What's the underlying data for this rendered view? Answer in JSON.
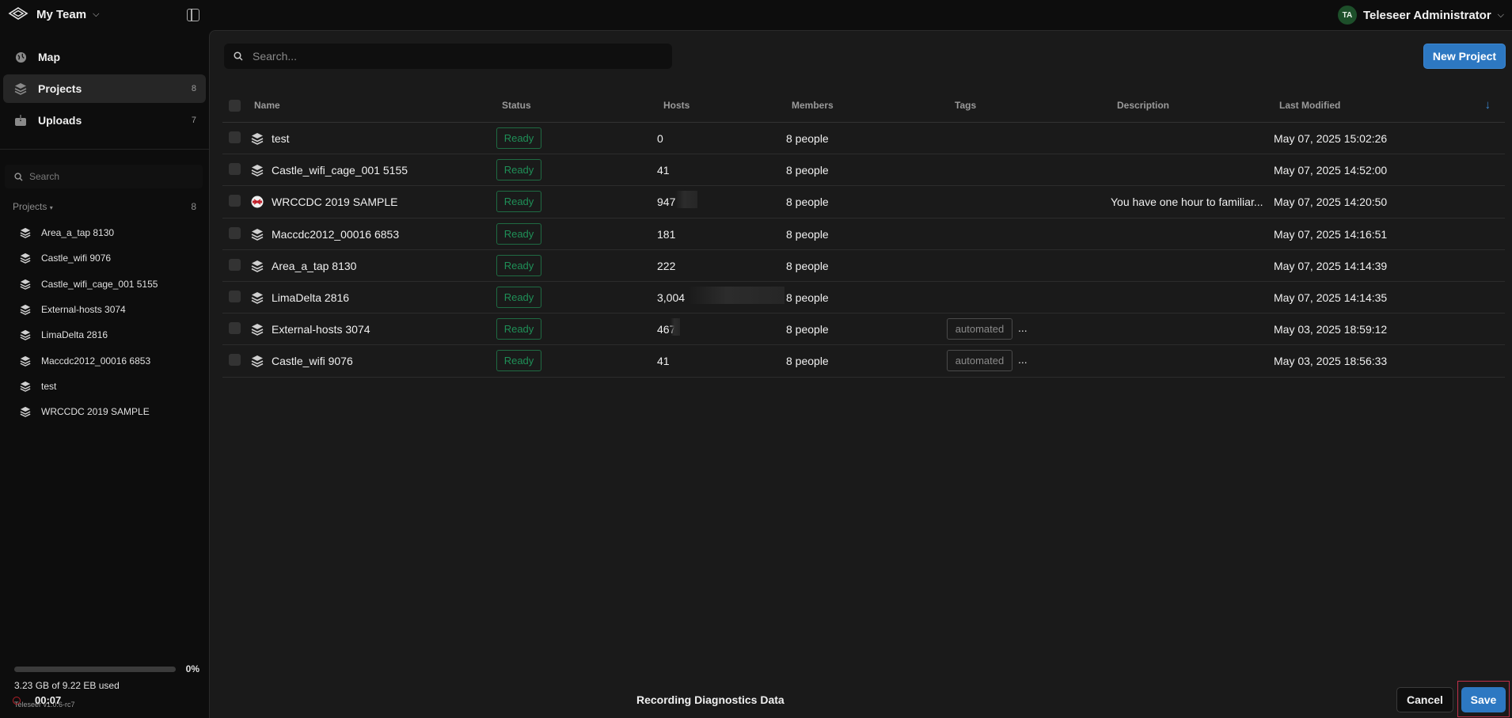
{
  "header": {
    "team": "My Team",
    "user_initials": "TA",
    "user_name": "Teleseer Administrator"
  },
  "nav": [
    {
      "label": "Map",
      "count": "",
      "icon": "globe-icon"
    },
    {
      "label": "Projects",
      "count": "8",
      "icon": "layers-icon"
    },
    {
      "label": "Uploads",
      "count": "7",
      "icon": "inbox-upload-icon"
    }
  ],
  "sidebar": {
    "search_placeholder": "Search",
    "projects_label": "Projects",
    "projects_count": "8",
    "projects": [
      "Area_a_tap 8130",
      "Castle_wifi 9076",
      "Castle_wifi_cage_001 5155",
      "External-hosts 3074",
      "LimaDelta 2816",
      "Maccdc2012_00016 6853",
      "test",
      "WRCCDC 2019 SAMPLE"
    ],
    "storage_pct": "0%",
    "storage_used": "3.23 GB of 9.22 EB used",
    "recording_time": "00:07",
    "version": "Teleseer v1.0.6-rc7"
  },
  "main": {
    "search_placeholder": "Search...",
    "new_project": "New Project",
    "columns": {
      "name": "Name",
      "status": "Status",
      "hosts": "Hosts",
      "members": "Members",
      "tags": "Tags",
      "description": "Description",
      "last_modified": "Last Modified"
    },
    "rows": [
      {
        "name": "test",
        "status": "Ready",
        "hosts": "0",
        "members": "8 people",
        "tag": "",
        "description": "",
        "modified": "May 07, 2025 15:02:26"
      },
      {
        "name": "Castle_wifi_cage_001 5155",
        "status": "Ready",
        "hosts": "41",
        "members": "8 people",
        "tag": "",
        "description": "",
        "modified": "May 07, 2025 14:52:00"
      },
      {
        "name": "WRCCDC 2019 SAMPLE",
        "status": "Ready",
        "hosts": "947",
        "members": "8 people",
        "tag": "",
        "description": "You have one hour to familiar...",
        "modified": "May 07, 2025 14:20:50"
      },
      {
        "name": "Maccdc2012_00016 6853",
        "status": "Ready",
        "hosts": "181",
        "members": "8 people",
        "tag": "",
        "description": "",
        "modified": "May 07, 2025 14:16:51"
      },
      {
        "name": "Area_a_tap 8130",
        "status": "Ready",
        "hosts": "222",
        "members": "8 people",
        "tag": "",
        "description": "",
        "modified": "May 07, 2025 14:14:39"
      },
      {
        "name": "LimaDelta 2816",
        "status": "Ready",
        "hosts": "3,004",
        "members": "8 people",
        "tag": "",
        "description": "",
        "modified": "May 07, 2025 14:14:35"
      },
      {
        "name": "External-hosts 3074",
        "status": "Ready",
        "hosts": "467",
        "members": "8 people",
        "tag": "automated",
        "description": "",
        "modified": "May 03, 2025 18:59:12"
      },
      {
        "name": "Castle_wifi 9076",
        "status": "Ready",
        "hosts": "41",
        "members": "8 people",
        "tag": "automated",
        "description": "",
        "modified": "May 03, 2025 18:56:33"
      }
    ]
  },
  "footer": {
    "label": "Recording Diagnostics Data",
    "cancel": "Cancel",
    "save": "Save"
  },
  "colors": {
    "accent": "#2d78c2",
    "ready": "#1f8f57",
    "highlight": "#c0304a"
  }
}
